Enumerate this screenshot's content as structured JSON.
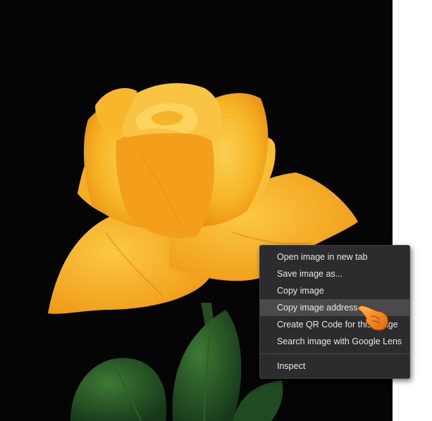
{
  "context_menu": {
    "items": [
      {
        "label": "Open image in new tab"
      },
      {
        "label": "Save image as..."
      },
      {
        "label": "Copy image"
      },
      {
        "label": "Copy image address"
      },
      {
        "label": "Create QR Code for this image"
      },
      {
        "label": "Search image with Google Lens"
      },
      {
        "label": "Inspect"
      }
    ],
    "hovered_item": "Copy image address"
  },
  "colors": {
    "menu_background": "#2c2c2e",
    "menu_text": "#e8e8ea",
    "hover_background": "#4a4a4d",
    "image_background": "#050505",
    "rose_petal": "#f7b526",
    "cursor": "#f07a14"
  },
  "icons": {
    "cursor": "pointing-hand-cursor-icon"
  }
}
